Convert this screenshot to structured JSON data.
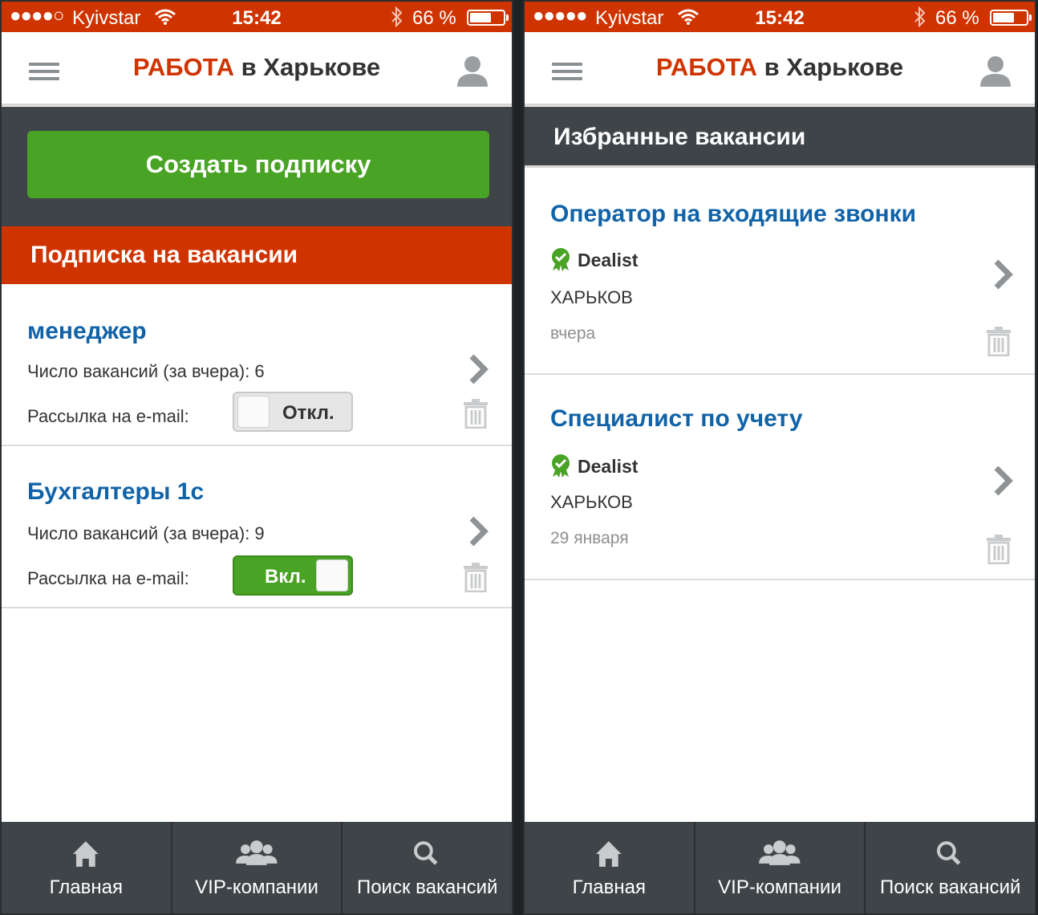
{
  "colors": {
    "brand_red": "#cf3400",
    "green": "#49a325",
    "link_blue": "#1163a8",
    "dark_gray": "#3f4448"
  },
  "statusbar": {
    "signal": "●●●●○",
    "signal_full": "●●●●●",
    "carrier": "Kyivstar",
    "time": "15:42",
    "battery": "66 %"
  },
  "header": {
    "brand_accent": "РАБОТА",
    "brand_rest": " в Харькове",
    "menu_icon": "hamburger-icon",
    "user_icon": "user-icon"
  },
  "left": {
    "create_button": "Создать подписку",
    "section_title": "Подписка на вакансии",
    "subscriptions": [
      {
        "title": "менеджер",
        "count_label": "Число вакансий (за вчера): 6",
        "email_label": "Рассылка на e-mail:",
        "toggle_text": "Откл.",
        "toggle_on": false
      },
      {
        "title": "Бухгалтеры 1с",
        "count_label": "Число вакансий (за вчера): 9",
        "email_label": "Рассылка на e-mail:",
        "toggle_text": "Вкл.",
        "toggle_on": true
      }
    ]
  },
  "right": {
    "section_title": "Избранные вакансии",
    "vacancies": [
      {
        "title": "Оператор на входящие звонки",
        "company": "Dealist",
        "city": "ХАРЬКОВ",
        "date": "вчера"
      },
      {
        "title": "Специалист по учету",
        "company": "Dealist",
        "city": "ХАРЬКОВ",
        "date": "29 января"
      }
    ]
  },
  "tabs": [
    {
      "label": "Главная",
      "icon": "home-icon"
    },
    {
      "label": "VIP-компании",
      "icon": "users-icon"
    },
    {
      "label": "Поиск вакансий",
      "icon": "search-icon"
    }
  ]
}
